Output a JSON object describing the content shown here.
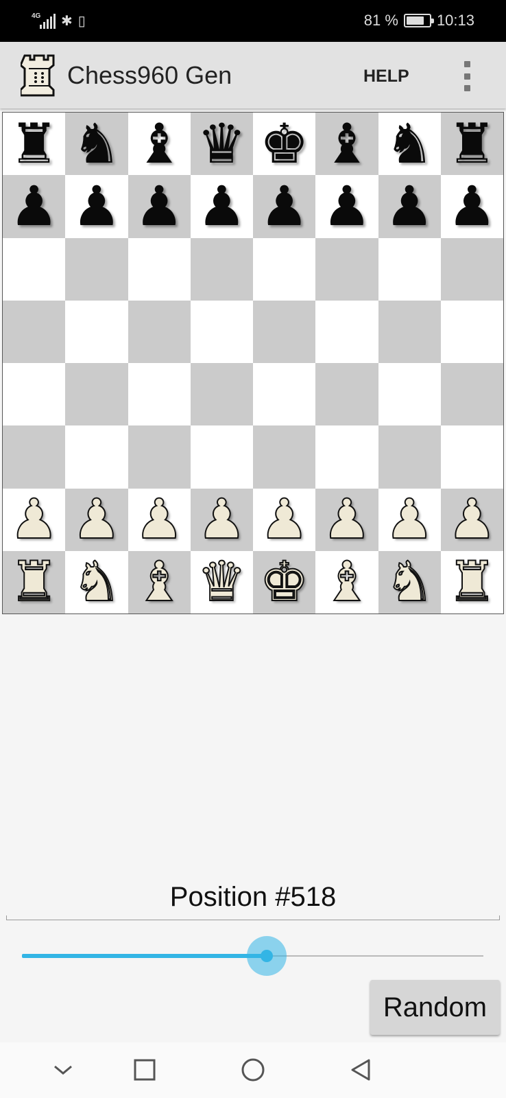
{
  "status_bar": {
    "network": "4G",
    "battery_text": "81 %",
    "battery_level": 0.81,
    "time": "10:13"
  },
  "app_bar": {
    "title": "Chess960 Gen",
    "help_label": "HELP",
    "icon": "rook-icon",
    "overflow_icon": "more-vert-icon"
  },
  "board": {
    "squares": [
      {
        "piece": "♜",
        "name": "black-rook"
      },
      {
        "piece": "♞",
        "name": "black-knight"
      },
      {
        "piece": "♝",
        "name": "black-bishop"
      },
      {
        "piece": "♛",
        "name": "black-queen"
      },
      {
        "piece": "♚",
        "name": "black-king"
      },
      {
        "piece": "♝",
        "name": "black-bishop"
      },
      {
        "piece": "♞",
        "name": "black-knight"
      },
      {
        "piece": "♜",
        "name": "black-rook"
      },
      {
        "piece": "♟",
        "name": "black-pawn"
      },
      {
        "piece": "♟",
        "name": "black-pawn"
      },
      {
        "piece": "♟",
        "name": "black-pawn"
      },
      {
        "piece": "♟",
        "name": "black-pawn"
      },
      {
        "piece": "♟",
        "name": "black-pawn"
      },
      {
        "piece": "♟",
        "name": "black-pawn"
      },
      {
        "piece": "♟",
        "name": "black-pawn"
      },
      {
        "piece": "♟",
        "name": "black-pawn"
      },
      {
        "piece": "",
        "name": "empty"
      },
      {
        "piece": "",
        "name": "empty"
      },
      {
        "piece": "",
        "name": "empty"
      },
      {
        "piece": "",
        "name": "empty"
      },
      {
        "piece": "",
        "name": "empty"
      },
      {
        "piece": "",
        "name": "empty"
      },
      {
        "piece": "",
        "name": "empty"
      },
      {
        "piece": "",
        "name": "empty"
      },
      {
        "piece": "",
        "name": "empty"
      },
      {
        "piece": "",
        "name": "empty"
      },
      {
        "piece": "",
        "name": "empty"
      },
      {
        "piece": "",
        "name": "empty"
      },
      {
        "piece": "",
        "name": "empty"
      },
      {
        "piece": "",
        "name": "empty"
      },
      {
        "piece": "",
        "name": "empty"
      },
      {
        "piece": "",
        "name": "empty"
      },
      {
        "piece": "",
        "name": "empty"
      },
      {
        "piece": "",
        "name": "empty"
      },
      {
        "piece": "",
        "name": "empty"
      },
      {
        "piece": "",
        "name": "empty"
      },
      {
        "piece": "",
        "name": "empty"
      },
      {
        "piece": "",
        "name": "empty"
      },
      {
        "piece": "",
        "name": "empty"
      },
      {
        "piece": "",
        "name": "empty"
      },
      {
        "piece": "",
        "name": "empty"
      },
      {
        "piece": "",
        "name": "empty"
      },
      {
        "piece": "",
        "name": "empty"
      },
      {
        "piece": "",
        "name": "empty"
      },
      {
        "piece": "",
        "name": "empty"
      },
      {
        "piece": "",
        "name": "empty"
      },
      {
        "piece": "",
        "name": "empty"
      },
      {
        "piece": "",
        "name": "empty"
      },
      {
        "piece": "♟",
        "name": "white-pawn"
      },
      {
        "piece": "♟",
        "name": "white-pawn"
      },
      {
        "piece": "♟",
        "name": "white-pawn"
      },
      {
        "piece": "♟",
        "name": "white-pawn"
      },
      {
        "piece": "♟",
        "name": "white-pawn"
      },
      {
        "piece": "♟",
        "name": "white-pawn"
      },
      {
        "piece": "♟",
        "name": "white-pawn"
      },
      {
        "piece": "♟",
        "name": "white-pawn"
      },
      {
        "piece": "♜",
        "name": "white-rook"
      },
      {
        "piece": "♞",
        "name": "white-knight"
      },
      {
        "piece": "♝",
        "name": "white-bishop"
      },
      {
        "piece": "♛",
        "name": "white-queen"
      },
      {
        "piece": "♚",
        "name": "white-king"
      },
      {
        "piece": "♝",
        "name": "white-bishop"
      },
      {
        "piece": "♞",
        "name": "white-knight"
      },
      {
        "piece": "♜",
        "name": "white-rook"
      }
    ]
  },
  "position": {
    "label": "Position #518",
    "slider_fraction": 0.53
  },
  "random_label": "Random",
  "nav_bar": {
    "icons": [
      "chevron-down-icon",
      "recents-square-icon",
      "home-circle-icon",
      "back-triangle-icon"
    ]
  },
  "colors": {
    "accent": "#33b5e5",
    "board_dark": "#cbcbcb",
    "board_light": "#ffffff",
    "app_bar": "#e2e2e2"
  }
}
